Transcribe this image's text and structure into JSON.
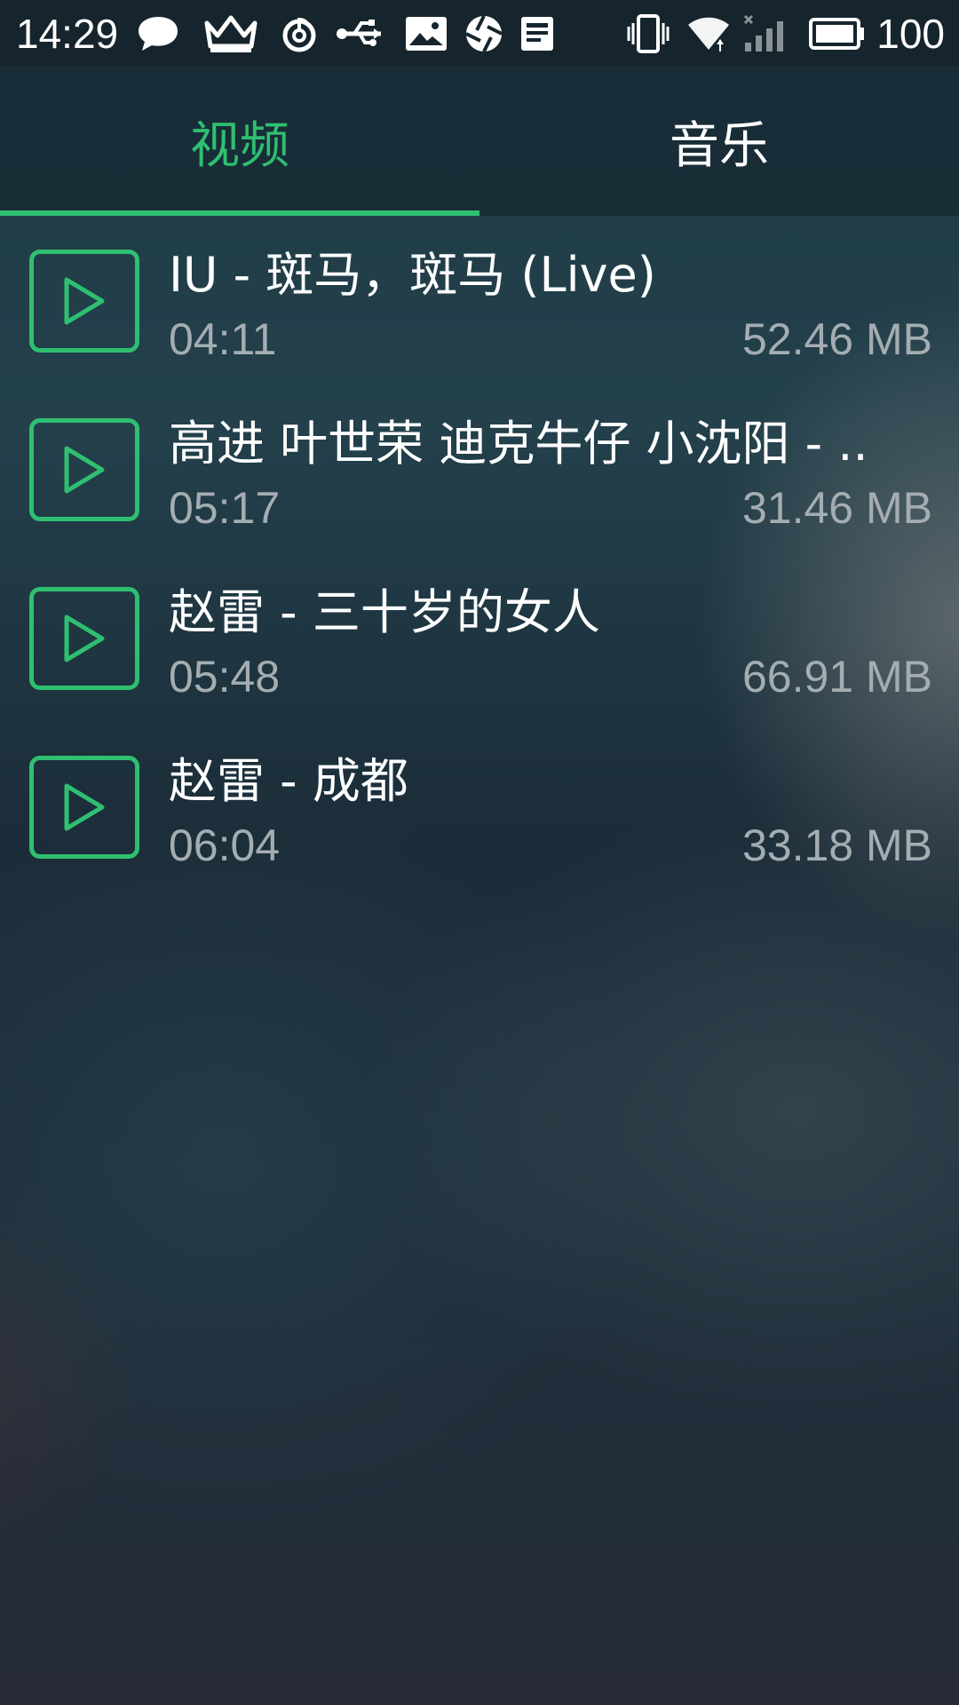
{
  "status_bar": {
    "time": "14:29",
    "battery_level": "100",
    "icons": [
      "chat-bubble-icon",
      "crown-icon",
      "netease-music-icon",
      "usb-icon",
      "image-icon",
      "aperture-icon",
      "news-icon",
      "vibrate-icon",
      "wifi-icon",
      "signal-icon",
      "battery-icon"
    ]
  },
  "tabs": [
    {
      "label": "视频",
      "active": true
    },
    {
      "label": "音乐",
      "active": false
    }
  ],
  "accent_color": "#2fbf71",
  "items": [
    {
      "title": "IU - 斑马，斑马 (Live)",
      "duration": "04:11",
      "size": "52.46 MB"
    },
    {
      "title": "高进 叶世荣 迪克牛仔 小沈阳 - ..",
      "duration": "05:17",
      "size": "31.46 MB"
    },
    {
      "title": "赵雷 - 三十岁的女人",
      "duration": "05:48",
      "size": "66.91 MB"
    },
    {
      "title": "赵雷 - 成都",
      "duration": "06:04",
      "size": "33.18 MB"
    }
  ]
}
